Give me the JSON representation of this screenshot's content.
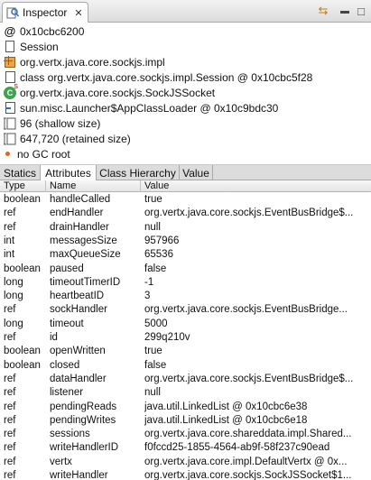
{
  "view_tab": {
    "title": "Inspector",
    "close_glyph": "✕"
  },
  "toolbar": {
    "sync_glyph": "⇆",
    "minimize_glyph": "▬",
    "maximize_glyph": "□"
  },
  "summary": {
    "address": "0x10cbc6200",
    "class_name": "Session",
    "package": "org.vertx.java.core.sockjs.impl",
    "class_object": "class org.vertx.java.core.sockjs.impl.Session @ 0x10cbc5f28",
    "superclass": "org.vertx.java.core.sockjs.SockJSSocket",
    "class_loader": "sun.misc.Launcher$AppClassLoader @ 0x10c9bdc30",
    "shallow_size": "96 (shallow size)",
    "retained_size": "647,720 (retained size)",
    "gc_root": "no GC root"
  },
  "detail_tabs": [
    "Statics",
    "Attributes",
    "Class Hierarchy",
    "Value"
  ],
  "active_tab": "Attributes",
  "table": {
    "headers": [
      "Type",
      "Name",
      "Value"
    ],
    "rows": [
      {
        "type": "boolean",
        "name": "handleCalled",
        "value": "true"
      },
      {
        "type": "ref",
        "name": "endHandler",
        "value": "org.vertx.java.core.sockjs.EventBusBridge$..."
      },
      {
        "type": "ref",
        "name": "drainHandler",
        "value": "null"
      },
      {
        "type": "int",
        "name": "messagesSize",
        "value": "957966"
      },
      {
        "type": "int",
        "name": "maxQueueSize",
        "value": "65536"
      },
      {
        "type": "boolean",
        "name": "paused",
        "value": "false"
      },
      {
        "type": "long",
        "name": "timeoutTimerID",
        "value": "-1"
      },
      {
        "type": "long",
        "name": "heartbeatID",
        "value": "3"
      },
      {
        "type": "ref",
        "name": "sockHandler",
        "value": "org.vertx.java.core.sockjs.EventBusBridge..."
      },
      {
        "type": "long",
        "name": "timeout",
        "value": "5000"
      },
      {
        "type": "ref",
        "name": "id",
        "value": "299q210v"
      },
      {
        "type": "boolean",
        "name": "openWritten",
        "value": "true"
      },
      {
        "type": "boolean",
        "name": "closed",
        "value": "false"
      },
      {
        "type": "ref",
        "name": "dataHandler",
        "value": "org.vertx.java.core.sockjs.EventBusBridge$..."
      },
      {
        "type": "ref",
        "name": "listener",
        "value": "null"
      },
      {
        "type": "ref",
        "name": "pendingReads",
        "value": "java.util.LinkedList @ 0x10cbc6e38"
      },
      {
        "type": "ref",
        "name": "pendingWrites",
        "value": "java.util.LinkedList @ 0x10cbc6e18"
      },
      {
        "type": "ref",
        "name": "sessions",
        "value": "org.vertx.java.core.shareddata.impl.Shared..."
      },
      {
        "type": "ref",
        "name": "writeHandlerID",
        "value": "f0fccd25-1855-4564-ab9f-58f237c90ead"
      },
      {
        "type": "ref",
        "name": "vertx",
        "value": "org.vertx.java.core.impl.DefaultVertx @ 0x..."
      },
      {
        "type": "ref",
        "name": "writeHandler",
        "value": "org.vertx.java.core.sockjs.SockJSSocket$1..."
      }
    ]
  }
}
